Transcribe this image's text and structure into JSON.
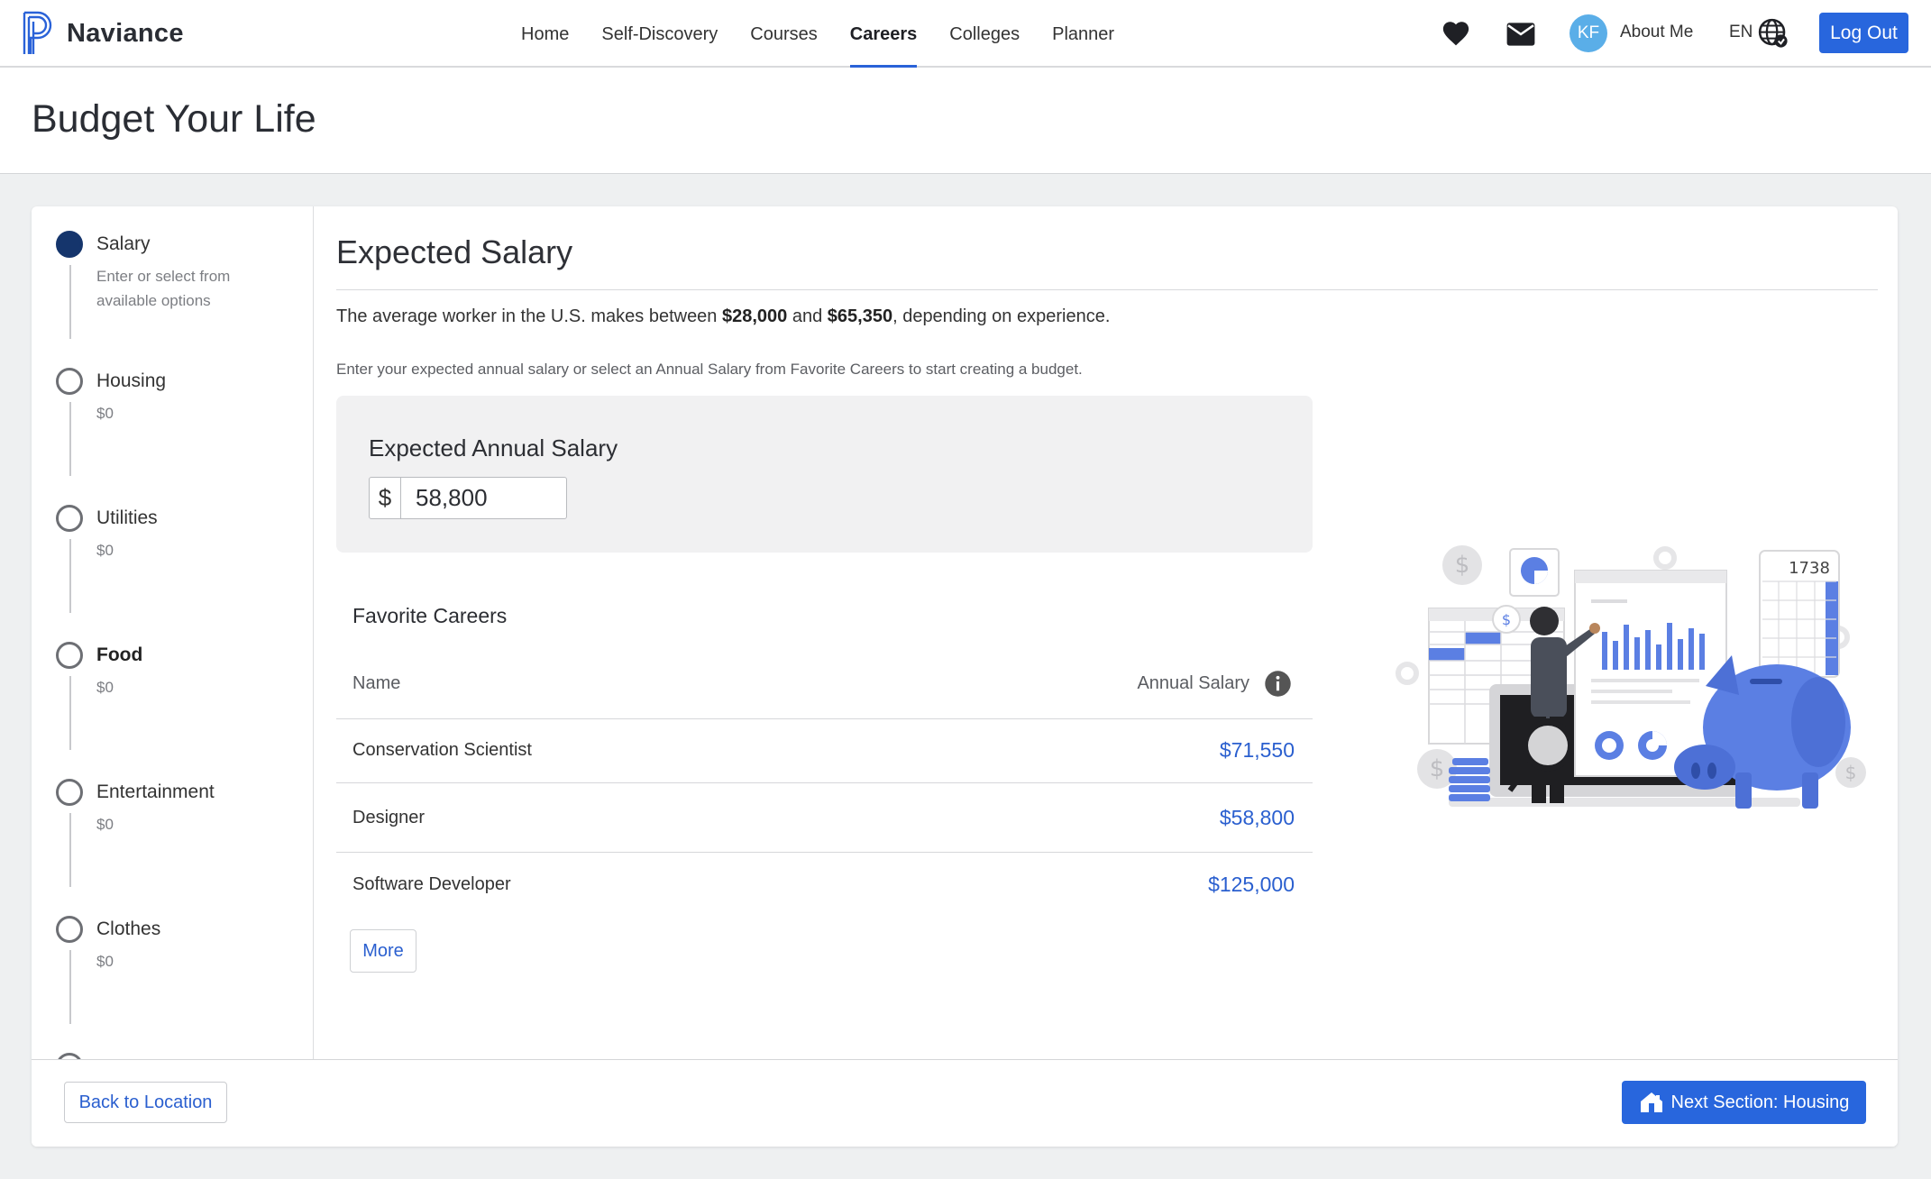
{
  "app": {
    "name": "Naviance"
  },
  "nav": {
    "items": [
      {
        "label": "Home"
      },
      {
        "label": "Self-Discovery"
      },
      {
        "label": "Courses"
      },
      {
        "label": "Careers",
        "active": true
      },
      {
        "label": "Colleges"
      },
      {
        "label": "Planner"
      }
    ]
  },
  "header": {
    "avatar_initials": "KF",
    "about_label": "About Me",
    "language": "EN",
    "logout_label": "Log Out",
    "accent_color": "#2866dd"
  },
  "page": {
    "title": "Budget Your Life"
  },
  "steps": [
    {
      "name": "Salary",
      "sub": "Enter or select from available options",
      "current": true
    },
    {
      "name": "Housing",
      "sub": "$0"
    },
    {
      "name": "Utilities",
      "sub": "$0"
    },
    {
      "name": "Food",
      "sub": "$0",
      "bold": true
    },
    {
      "name": "Entertainment",
      "sub": "$0"
    },
    {
      "name": "Clothes",
      "sub": "$0"
    }
  ],
  "main": {
    "title": "Expected Salary",
    "intro_pre": "The average worker in the U.S. makes between ",
    "intro_low": "$28,000",
    "intro_mid": " and ",
    "intro_high": "$65,350",
    "intro_post": ", depending on experience.",
    "hint": "Enter your expected annual salary or select an Annual Salary from Favorite Careers to start creating a budget.",
    "salary_label": "Expected Annual Salary",
    "currency_symbol": "$",
    "salary_value": "58,800"
  },
  "favorites": {
    "title": "Favorite Careers",
    "col_name": "Name",
    "col_salary": "Annual Salary",
    "rows": [
      {
        "name": "Conservation Scientist",
        "salary": "$71,550"
      },
      {
        "name": "Designer",
        "salary": "$58,800"
      },
      {
        "name": "Software Developer",
        "salary": "$125,000"
      }
    ],
    "more_label": "More"
  },
  "illustration": {
    "calculator_display": "1738"
  },
  "footer": {
    "back_label": "Back to Location",
    "next_label": "Next Section: Housing"
  }
}
